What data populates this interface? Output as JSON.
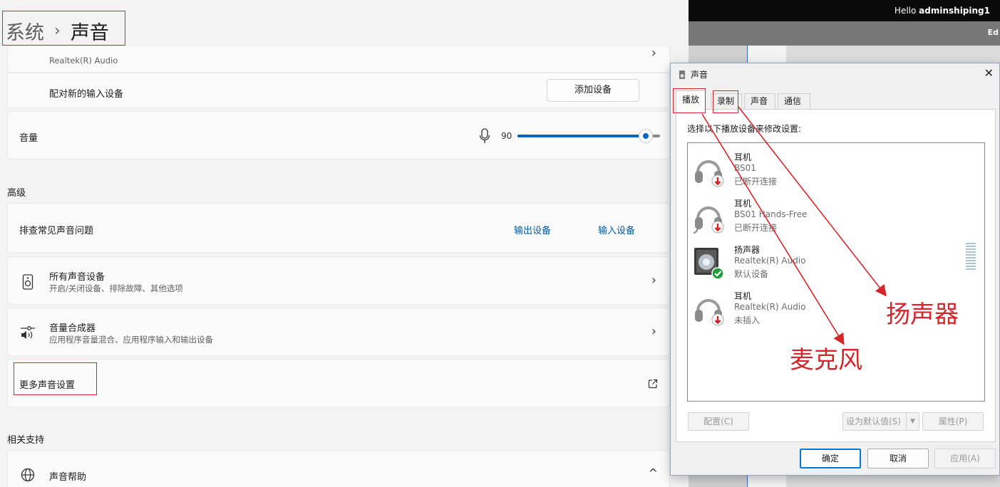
{
  "settings": {
    "breadcrumb": {
      "root": "系统",
      "separator": "›",
      "current": "声音"
    },
    "input_device_partial": {
      "subtitle": "Realtek(R) Audio"
    },
    "pair_new_input": {
      "label": "配对新的输入设备",
      "button": "添加设备"
    },
    "volume": {
      "label": "音量",
      "value": "90",
      "level_percent": 90
    },
    "advanced_heading": "高级",
    "troubleshoot": {
      "label": "排查常见声音问题",
      "link_output": "输出设备",
      "link_input": "输入设备"
    },
    "all_devices": {
      "title": "所有声音设备",
      "subtitle": "开启/关闭设备、排除故障、其他选项"
    },
    "mixer": {
      "title": "音量合成器",
      "subtitle": "应用程序音量混合、应用程序输入和输出设备"
    },
    "more_settings": {
      "label": "更多声音设置"
    },
    "related_heading": "相关支持",
    "sound_help": {
      "label": "声音帮助"
    }
  },
  "background_app": {
    "hello_prefix": "Hello ",
    "username": "adminshiping1",
    "ed_label": "Ed"
  },
  "dialog": {
    "title": "声音",
    "tabs": [
      "播放",
      "录制",
      "声音",
      "通信"
    ],
    "instruction": "选择以下播放设备来修改设置:",
    "devices": [
      {
        "name": "耳机",
        "driver": "BS01",
        "status": "已断开连接",
        "icon": "headphones-icon",
        "badge": "disconnected-badge"
      },
      {
        "name": "耳机",
        "driver": "BS01 Hands-Free",
        "status": "已断开连接",
        "icon": "headset-icon",
        "badge": "disconnected-badge"
      },
      {
        "name": "扬声器",
        "driver": "Realtek(R) Audio",
        "status": "默认设备",
        "icon": "speaker-icon",
        "badge": "default-check-badge"
      },
      {
        "name": "耳机",
        "driver": "Realtek(R) Audio",
        "status": "未插入",
        "icon": "headphones-icon",
        "badge": "disconnected-badge"
      }
    ],
    "buttons": {
      "configure": "配置(C)",
      "set_default": "设为默认值(S)",
      "properties": "属性(P)",
      "ok": "确定",
      "cancel": "取消",
      "apply": "应用(A)"
    }
  },
  "annotations": {
    "microphone": "麦克风",
    "speaker": "扬声器"
  },
  "colors": {
    "accent": "#0067c0",
    "annotation_red": "#d6262c",
    "link": "#005a9e"
  }
}
